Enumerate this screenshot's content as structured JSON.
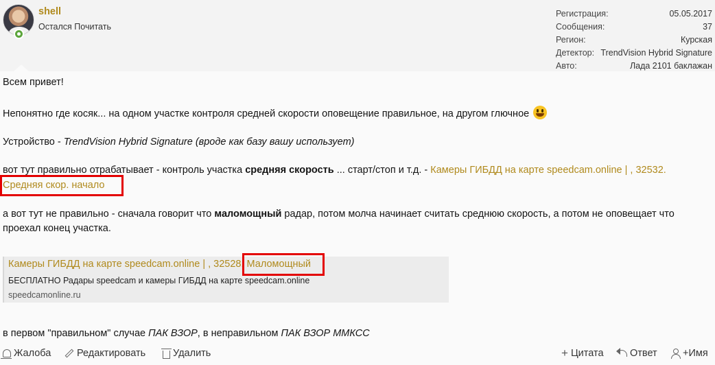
{
  "user": {
    "name": "shell",
    "title": "Остался Почитать"
  },
  "stats": [
    {
      "label": "Регистрация:",
      "value": "05.05.2017"
    },
    {
      "label": "Сообщения:",
      "value": "37"
    },
    {
      "label": "Регион:",
      "value": "Курская"
    },
    {
      "label": "Детектор:",
      "value": "TrendVision Hybrid Signature"
    },
    {
      "label": "Авто:",
      "value": "Лада 2101 баклажан"
    }
  ],
  "post": {
    "greeting": "Всем привет!",
    "p2": "Непонятно где косяк... на одном участке контроля средней скорости оповещение правильное, на другом глючное",
    "p3_prefix": "Устройство - ",
    "p3_italic": "TrendVision Hybrid Signature (вроде как базу вашу использует)",
    "p4_a": "вот тут правильно отрабатывает - контроль участка ",
    "p4_bold": "средняя скорость",
    "p4_b": " ... старт/стоп и т.д. - ",
    "p4_link": "Камеры ГИБДД на карте speedcam.online | , 32532.",
    "p4_link2": "Средняя скор. начало",
    "p5_a": "а вот тут не правильно - сначала говорит что ",
    "p5_bold": "маломощный",
    "p5_b": " радар, потом молча начинает считать среднюю скорость, а потом не оповещает что",
    "p5_c": "проехал конец участка.",
    "p6_a": "в первом \"правильном\" случае ",
    "p6_i1": "ПАК ВЗОР",
    "p6_b": ", в неправильном ",
    "p6_i2": "ПАК ВЗОР ММКСС"
  },
  "unfurl": {
    "title": "Камеры ГИБДД на карте speedcam.online | , 32528. Маломощный",
    "description": "БЕСПЛАТНО Радары speedcam и камеры ГИБДД на карте speedcam.online",
    "domain": "speedcamonline.ru"
  },
  "actions": {
    "report": "Жалоба",
    "edit": "Редактировать",
    "delete": "Удалить",
    "quote": "Цитата",
    "reply": "Ответ",
    "mention": "+Имя"
  },
  "colors": {
    "accent_link": "#b08a1d",
    "highlight_box": "#e30000",
    "online_status": "#5ca53b"
  }
}
